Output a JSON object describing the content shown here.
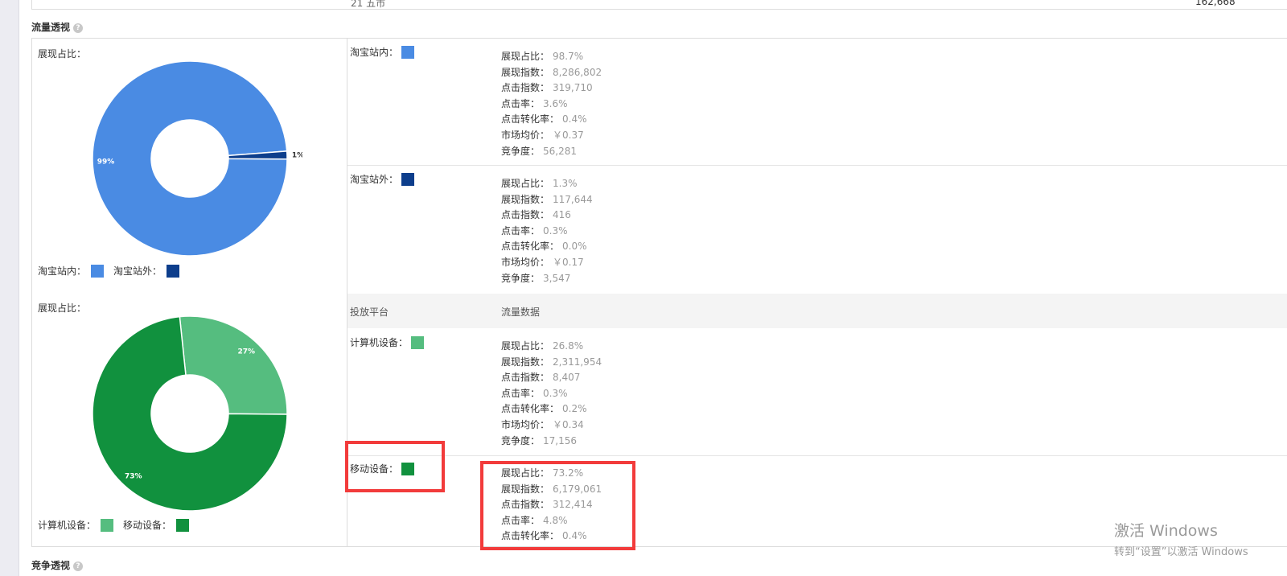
{
  "colors": {
    "taobao_in": "#4a8be3",
    "taobao_out": "#0d3e8c",
    "pc": "#55bd7f",
    "mobile": "#11913e",
    "highlight": "#f23b3b"
  },
  "top_strip": {
    "left_cut": "21  五市",
    "right_cut": "162,668"
  },
  "section": {
    "title": "流量透视",
    "help_icon": "question-icon"
  },
  "chart1": {
    "label": "展现占比：",
    "legend": [
      {
        "label": "淘宝站内：",
        "color": "#4a8be3"
      },
      {
        "label": "淘宝站外：",
        "color": "#0d3e8c"
      }
    ]
  },
  "chart2": {
    "label": "展现占比：",
    "legend": [
      {
        "label": "计算机设备：",
        "color": "#55bd7f"
      },
      {
        "label": "移动设备：",
        "color": "#11913e"
      }
    ]
  },
  "chart_data": [
    {
      "type": "pie",
      "donut": true,
      "title": "展现占比：",
      "categories": [
        "淘宝站内",
        "淘宝站外"
      ],
      "values": [
        98.7,
        1.3
      ],
      "data_labels": [
        "99%",
        "1%"
      ],
      "colors": [
        "#4a8be3",
        "#0d3e8c"
      ]
    },
    {
      "type": "pie",
      "donut": true,
      "title": "展现占比：",
      "categories": [
        "计算机设备",
        "移动设备"
      ],
      "values": [
        26.8,
        73.2
      ],
      "data_labels": [
        "27%",
        "73%"
      ],
      "colors": [
        "#55bd7f",
        "#11913e"
      ]
    }
  ],
  "rows": {
    "taobao_in": {
      "platform": "淘宝站内：",
      "color": "#4a8be3",
      "metrics": [
        {
          "k": "展现占比：",
          "v": "98.7%"
        },
        {
          "k": "展现指数：",
          "v": "8,286,802"
        },
        {
          "k": "点击指数：",
          "v": "319,710"
        },
        {
          "k": "点击率：",
          "v": "3.6%"
        },
        {
          "k": "点击转化率：",
          "v": "0.4%"
        },
        {
          "k": "市场均价：",
          "v": "￥0.37"
        },
        {
          "k": "竞争度：",
          "v": "56,281"
        }
      ]
    },
    "taobao_out": {
      "platform": "淘宝站外：",
      "color": "#0d3e8c",
      "metrics": [
        {
          "k": "展现占比：",
          "v": "1.3%"
        },
        {
          "k": "展现指数：",
          "v": "117,644"
        },
        {
          "k": "点击指数：",
          "v": "416"
        },
        {
          "k": "点击率：",
          "v": "0.3%"
        },
        {
          "k": "点击转化率：",
          "v": "0.0%"
        },
        {
          "k": "市场均价：",
          "v": "￥0.17"
        },
        {
          "k": "竞争度：",
          "v": "3,547"
        }
      ]
    },
    "header": {
      "col1": "投放平台",
      "col2": "流量数据"
    },
    "pc": {
      "platform": "计算机设备：",
      "color": "#55bd7f",
      "metrics": [
        {
          "k": "展现占比：",
          "v": "26.8%"
        },
        {
          "k": "展现指数：",
          "v": "2,311,954"
        },
        {
          "k": "点击指数：",
          "v": "8,407"
        },
        {
          "k": "点击率：",
          "v": "0.3%"
        },
        {
          "k": "点击转化率：",
          "v": "0.2%"
        },
        {
          "k": "市场均价：",
          "v": "￥0.34"
        },
        {
          "k": "竞争度：",
          "v": "17,156"
        }
      ]
    },
    "mobile": {
      "platform": "移动设备：",
      "color": "#11913e",
      "metrics": [
        {
          "k": "展现占比：",
          "v": "73.2%"
        },
        {
          "k": "展现指数：",
          "v": "6,179,061"
        },
        {
          "k": "点击指数：",
          "v": "312,414"
        },
        {
          "k": "点击率：",
          "v": "4.8%"
        },
        {
          "k": "点击转化率：",
          "v": "0.4%"
        }
      ]
    }
  },
  "watermark": {
    "line1": "激活 Windows",
    "line2": "转到“设置”以激活 Windows"
  },
  "bottom_section": {
    "title": "竞争透视",
    "help_icon": "question-icon"
  }
}
